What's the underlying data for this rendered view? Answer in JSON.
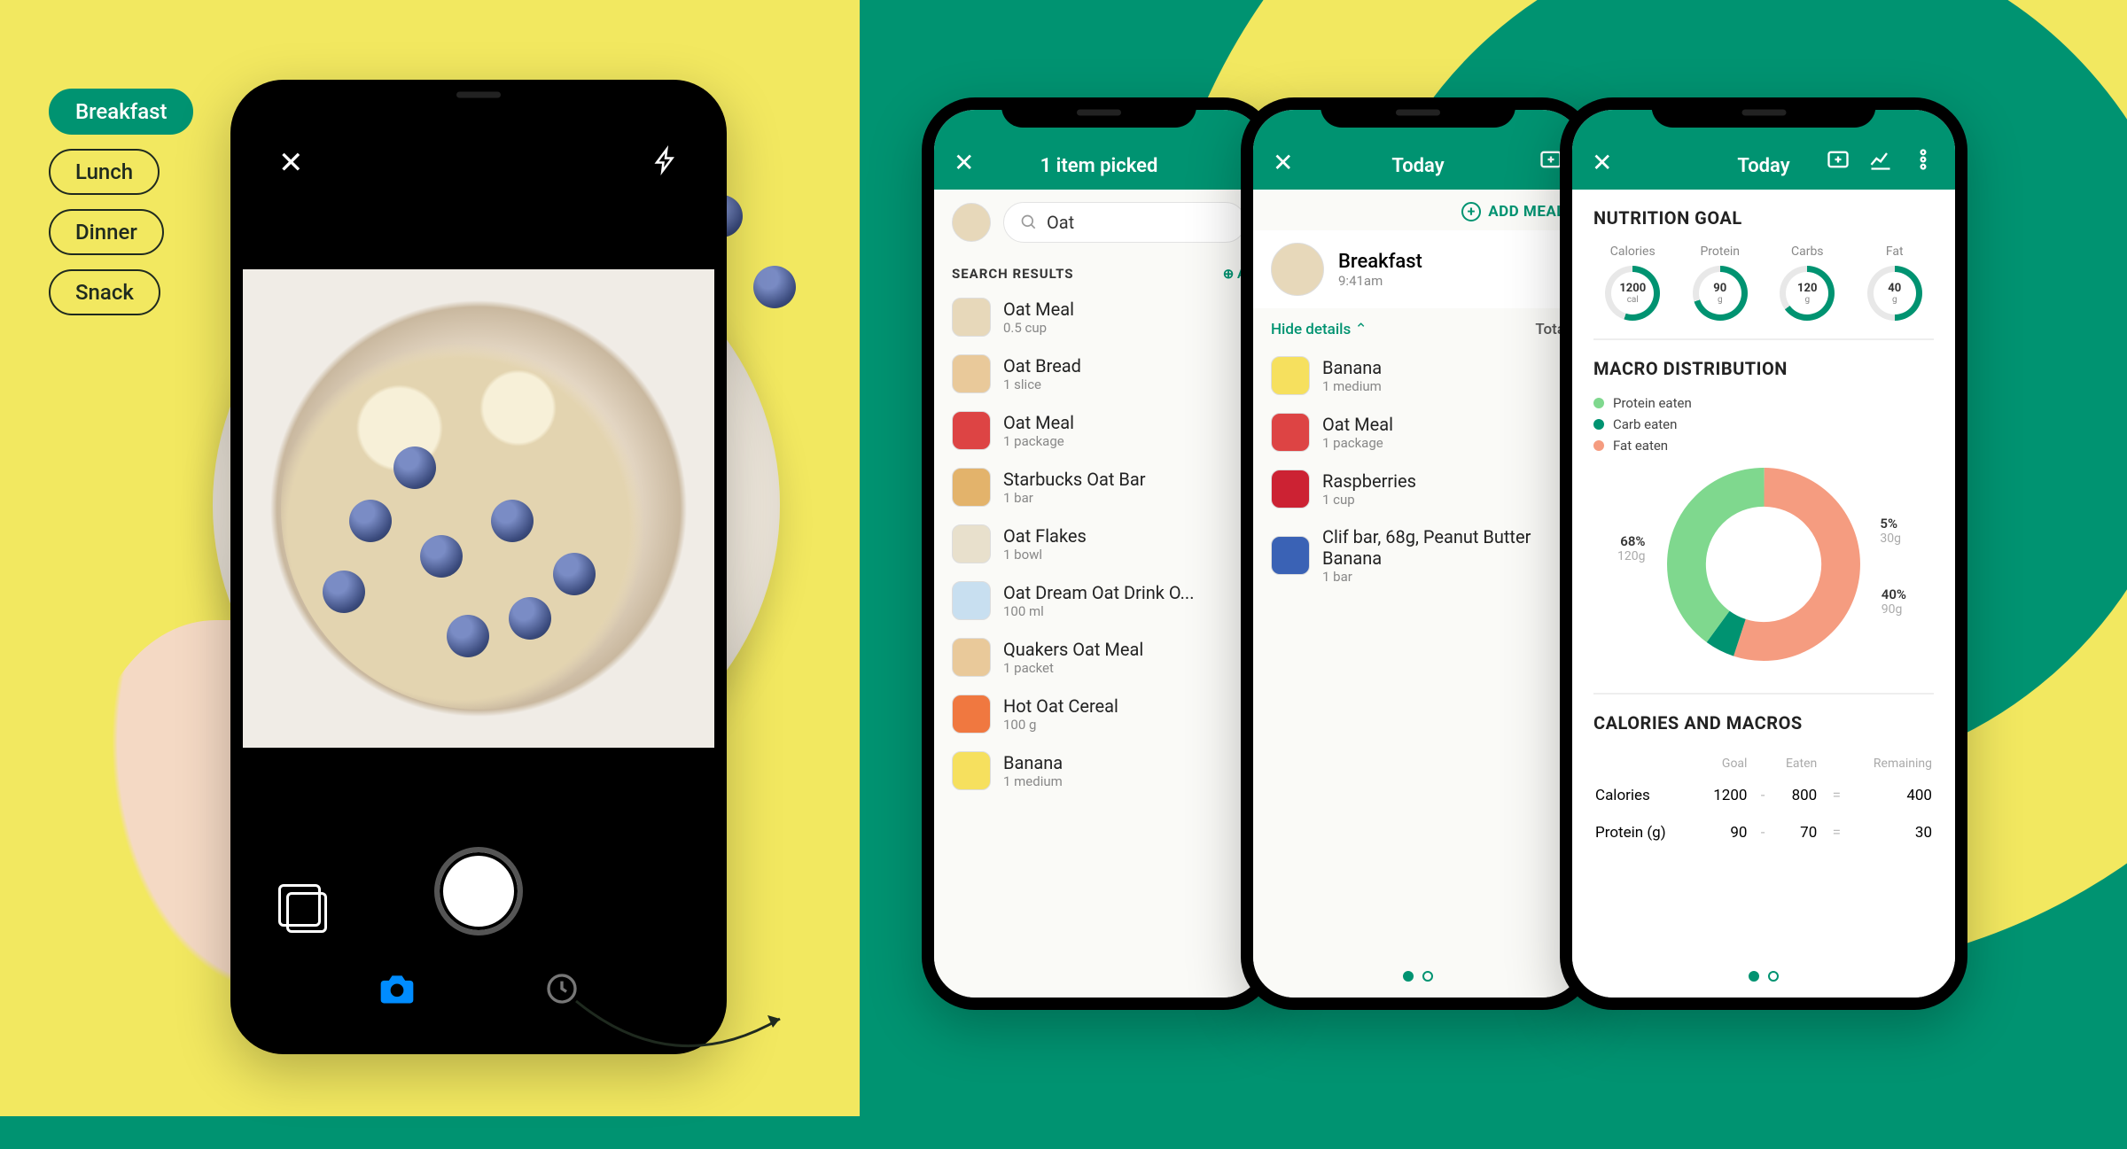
{
  "pills": {
    "breakfast": "Breakfast",
    "lunch": "Lunch",
    "dinner": "Dinner",
    "snack": "Snack"
  },
  "search_phone": {
    "header": "1 item picked",
    "query": "Oat",
    "section": "SEARCH RESULTS",
    "add_link": "A",
    "results": [
      {
        "name": "Oat Meal",
        "sub": "0.5 cup"
      },
      {
        "name": "Oat Bread",
        "sub": "1 slice"
      },
      {
        "name": "Oat Meal",
        "sub": "1 package"
      },
      {
        "name": "Starbucks Oat Bar",
        "sub": "1 bar"
      },
      {
        "name": "Oat Flakes",
        "sub": "1 bowl"
      },
      {
        "name": "Oat Dream Oat Drink O...",
        "sub": "100 ml"
      },
      {
        "name": "Quakers Oat Meal",
        "sub": "1 packet"
      },
      {
        "name": "Hot Oat Cereal",
        "sub": "100 g"
      },
      {
        "name": "Banana",
        "sub": "1 medium"
      }
    ]
  },
  "meal_phone": {
    "header": "Today",
    "add_meal": "ADD MEAL",
    "meal_name": "Breakfast",
    "meal_time": "9:41am",
    "hide": "Hide details",
    "total_label": "Tota",
    "items": [
      {
        "name": "Banana",
        "sub": "1 medium"
      },
      {
        "name": "Oat Meal",
        "sub": "1 package"
      },
      {
        "name": "Raspberries",
        "sub": "1 cup"
      },
      {
        "name": "Clif bar, 68g, Peanut Butter Banana",
        "sub": "1 bar"
      }
    ]
  },
  "nutrition_phone": {
    "header": "Today",
    "goal_title": "NUTRITION GOAL",
    "goals": [
      {
        "label": "Calories",
        "value": "1200",
        "unit": "cal",
        "pct": 55
      },
      {
        "label": "Protein",
        "value": "90",
        "unit": "g",
        "pct": 70
      },
      {
        "label": "Carbs",
        "value": "120",
        "unit": "g",
        "pct": 65
      },
      {
        "label": "Fat",
        "value": "40",
        "unit": "g",
        "pct": 50
      }
    ],
    "macro_title": "MACRO DISTRIBUTION",
    "legend": {
      "protein": "Protein eaten",
      "carb": "Carb eaten",
      "fat": "Fat eaten"
    },
    "donut": {
      "fat": {
        "pct": "68%",
        "g": "120g"
      },
      "carb": {
        "pct": "5%",
        "g": "30g"
      },
      "protein": {
        "pct": "40%",
        "g": "90g"
      }
    },
    "cals_title": "CALORIES AND MACROS",
    "table_headers": {
      "goal": "Goal",
      "eaten": "Eaten",
      "remaining": "Remaining"
    },
    "rows": [
      {
        "label": "Calories",
        "goal": "1200",
        "eaten": "800",
        "remaining": "400"
      },
      {
        "label": "Protein (g)",
        "goal": "90",
        "eaten": "70",
        "remaining": "30"
      }
    ]
  },
  "colors": {
    "teal": "#009371",
    "protein": "#7fd88e",
    "carb": "#009371",
    "fat": "#f59c80"
  },
  "chart_data": {
    "type": "pie",
    "title": "MACRO DISTRIBUTION",
    "series": [
      {
        "name": "Fat eaten",
        "pct": 68,
        "grams": 120,
        "color": "#f59c80"
      },
      {
        "name": "Carb eaten",
        "pct": 5,
        "grams": 30,
        "color": "#009371"
      },
      {
        "name": "Protein eaten",
        "pct": 40,
        "grams": 90,
        "color": "#7fd88e"
      }
    ],
    "note": "percentages as printed on screen; they do not sum to 100"
  }
}
